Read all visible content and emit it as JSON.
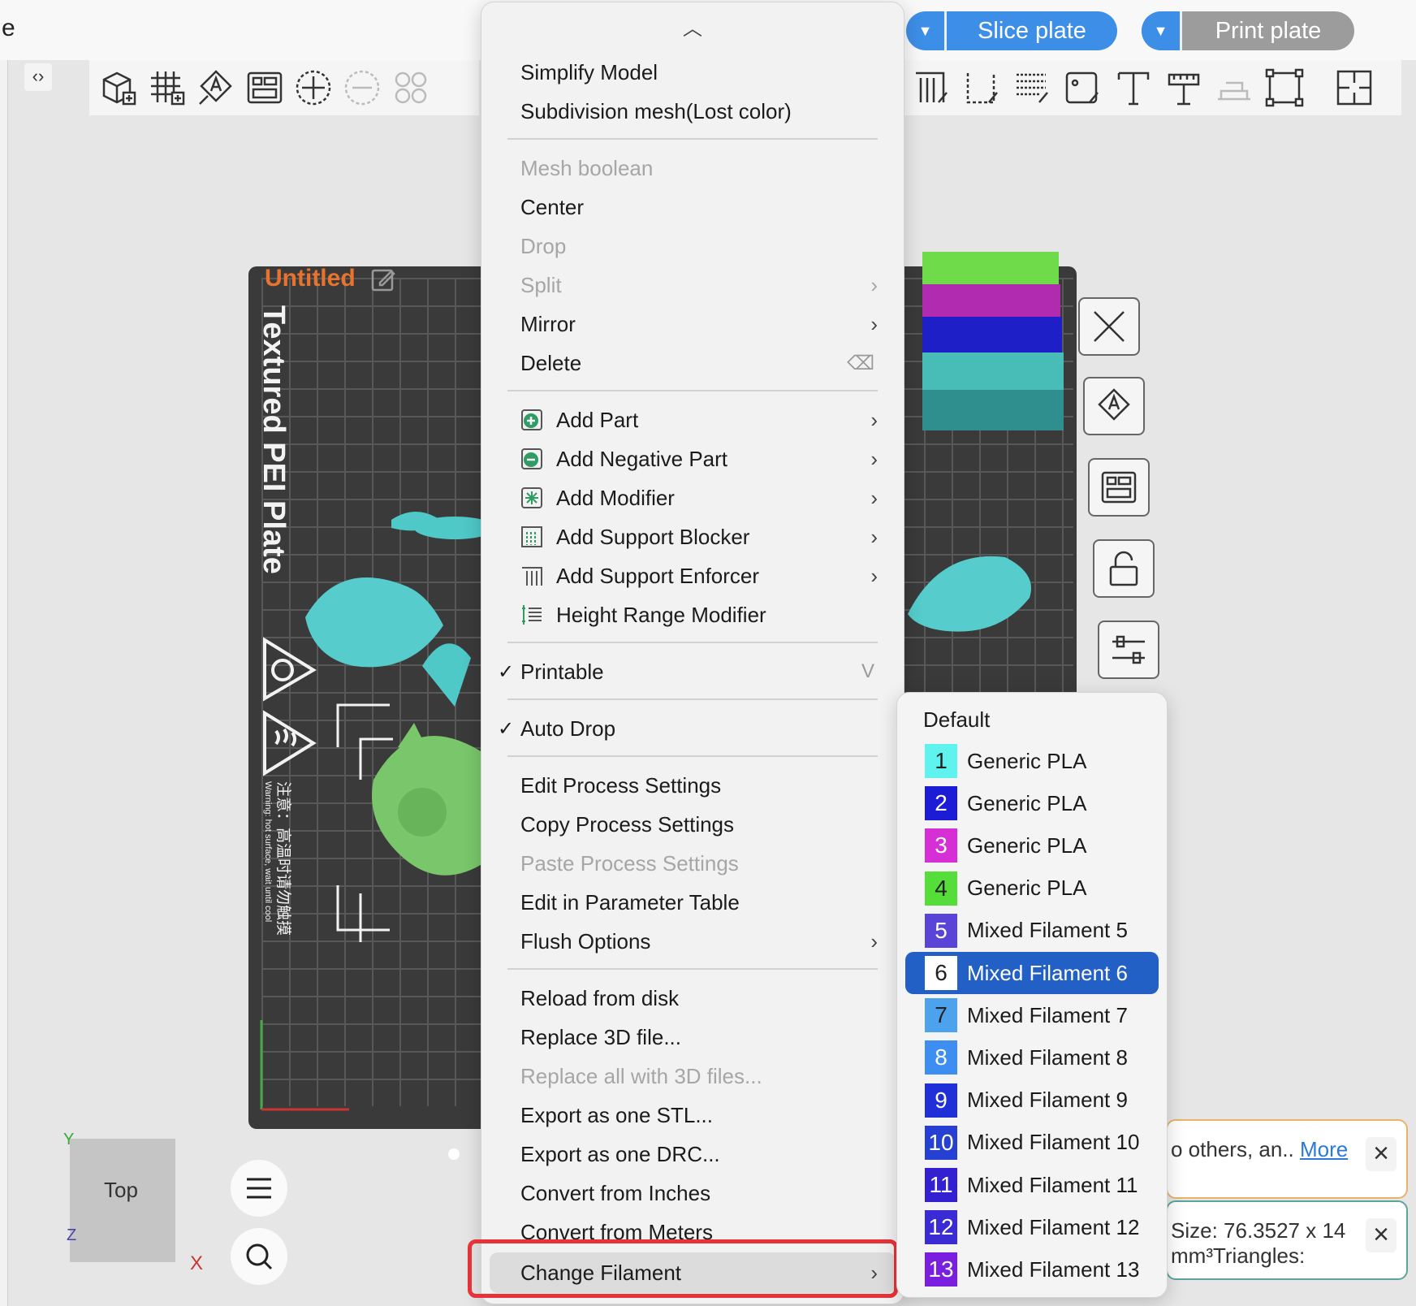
{
  "window": {
    "title_fragment": "e"
  },
  "header": {
    "slice_label": "Slice plate",
    "print_label": "Print plate",
    "accent": "#3d8ee6",
    "disabled_color": "#9c9c9c"
  },
  "plate": {
    "project_name": "Untitled",
    "plate_name": "Textured PEI Plate",
    "warning_cn": "注意：高温时请勿触摸",
    "warning_en": "Warning: hot surface, wait until cool"
  },
  "nav": {
    "view_label": "Top",
    "axis_y": "Y",
    "axis_z": "Z",
    "axis_x": "X"
  },
  "notifications": [
    {
      "text": "o others, an..",
      "link": "More"
    },
    {
      "text": "Size: 76.3527 x 14 mm³Triangles:"
    }
  ],
  "context_menu": {
    "items": [
      {
        "label": "Simplify Model"
      },
      {
        "label": "Subdivision mesh(Lost color)"
      },
      {
        "label": "Mesh boolean",
        "disabled": true
      },
      {
        "label": "Center"
      },
      {
        "label": "Drop",
        "disabled": true
      },
      {
        "label": "Split",
        "disabled": true,
        "submenu": true
      },
      {
        "label": "Mirror",
        "submenu": true
      },
      {
        "label": "Delete",
        "shortcut_icon": "backspace-icon"
      },
      {
        "label": "Add Part",
        "icon": "add-part-icon",
        "submenu": true
      },
      {
        "label": "Add Negative Part",
        "icon": "negative-part-icon",
        "submenu": true
      },
      {
        "label": "Add Modifier",
        "icon": "modifier-icon",
        "submenu": true
      },
      {
        "label": "Add Support Blocker",
        "icon": "support-blocker-icon",
        "submenu": true
      },
      {
        "label": "Add Support Enforcer",
        "icon": "support-enforcer-icon",
        "submenu": true
      },
      {
        "label": "Height Range Modifier",
        "icon": "height-range-icon"
      },
      {
        "label": "Printable",
        "checked": true,
        "shortcut": "V"
      },
      {
        "label": "Auto Drop",
        "checked": true
      },
      {
        "label": "Edit Process Settings"
      },
      {
        "label": "Copy Process Settings"
      },
      {
        "label": "Paste Process Settings",
        "disabled": true
      },
      {
        "label": "Edit in Parameter Table"
      },
      {
        "label": "Flush Options",
        "submenu": true
      },
      {
        "label": "Reload from disk"
      },
      {
        "label": "Replace 3D file..."
      },
      {
        "label": "Replace all with 3D files...",
        "disabled": true
      },
      {
        "label": "Export as one STL..."
      },
      {
        "label": "Export as one DRC..."
      },
      {
        "label": "Convert from Inches"
      },
      {
        "label": "Convert from Meters"
      },
      {
        "label": "Change Filament",
        "submenu": true,
        "highlighted": true
      }
    ]
  },
  "filament_submenu": {
    "default_label": "Default",
    "items": [
      {
        "num": "1",
        "label": "Generic PLA",
        "color": "#5ef3ee",
        "num_color": "#222222"
      },
      {
        "num": "2",
        "label": "Generic PLA",
        "color": "#1c1cd6",
        "num_color": "#ffffff"
      },
      {
        "num": "3",
        "label": "Generic PLA",
        "color": "#d62fd6",
        "num_color": "#ffffff"
      },
      {
        "num": "4",
        "label": "Generic PLA",
        "color": "#55dd3a",
        "num_color": "#222222"
      },
      {
        "num": "5",
        "label": "Mixed Filament 5",
        "color": "#5a44d8",
        "num_color": "#ffffff"
      },
      {
        "num": "6",
        "label": "Mixed Filament 6",
        "color": "#ffffff",
        "num_color": "#222222",
        "selected": true
      },
      {
        "num": "7",
        "label": "Mixed Filament 7",
        "color": "#4da2ee",
        "num_color": "#222222"
      },
      {
        "num": "8",
        "label": "Mixed Filament 8",
        "color": "#3d8ef0",
        "num_color": "#ffffff"
      },
      {
        "num": "9",
        "label": "Mixed Filament 9",
        "color": "#2030d8",
        "num_color": "#ffffff"
      },
      {
        "num": "10",
        "label": "Mixed Filament 10",
        "color": "#2640d4",
        "num_color": "#ffffff"
      },
      {
        "num": "11",
        "label": "Mixed Filament 11",
        "color": "#3320d0",
        "num_color": "#ffffff"
      },
      {
        "num": "12",
        "label": "Mixed Filament 12",
        "color": "#3a2bd4",
        "num_color": "#ffffff"
      },
      {
        "num": "13",
        "label": "Mixed Filament 13",
        "color": "#7a1ee0",
        "num_color": "#ffffff"
      }
    ]
  }
}
